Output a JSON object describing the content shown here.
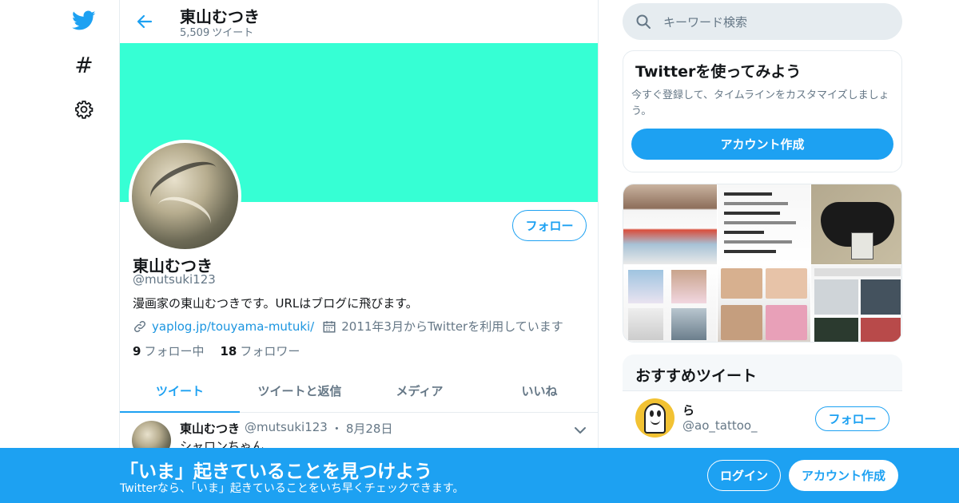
{
  "nav": {
    "icons": [
      "twitter-bird-icon",
      "hashtag-icon",
      "gear-icon"
    ],
    "hash_glyph": "#"
  },
  "header": {
    "name": "東山むつき",
    "tweet_count": "5,509",
    "tweet_count_label": "ツイート"
  },
  "profile": {
    "banner_color": "#36ffd4",
    "follow_label": "フォロー",
    "name": "東山むつき",
    "handle": "@mutsuki123",
    "bio": "漫画家の東山むつきです。URLはブログに飛びます。",
    "link": "yaplog.jp/touyama-mutuki/",
    "joined": "2011年3月からTwitterを利用しています",
    "following_count": "9",
    "following_label": "フォロー中",
    "followers_count": "18",
    "followers_label": "フォロワー"
  },
  "tabs": [
    {
      "label": "ツイート",
      "active": true
    },
    {
      "label": "ツイートと返信",
      "active": false
    },
    {
      "label": "メディア",
      "active": false
    },
    {
      "label": "いいね",
      "active": false
    }
  ],
  "tweet": {
    "name": "東山むつき",
    "handle": "@mutsuki123",
    "separator": "・",
    "date": "8月28日",
    "text": "シャロンちゃん"
  },
  "search": {
    "placeholder": "キーワード検索"
  },
  "signup_card": {
    "title": "Twitterを使ってみよう",
    "description": "今すぐ登録して、タイムラインをカスタマイズしましょう。",
    "button_label": "アカウント作成"
  },
  "recommended": {
    "heading": "おすすめツイート",
    "user_name": "ら",
    "user_handle": "@ao_tattoo_",
    "follow_label": "フォロー"
  },
  "bottom_bar": {
    "headline": "「いま」起きていることを見つけよう",
    "subline": "Twitterなら、「いま」起きていることをいち早くチェックできます。",
    "login_label": "ログイン",
    "signup_label": "アカウント作成"
  },
  "colors": {
    "accent": "#1da1f2",
    "banner": "#36ffd4",
    "muted": "#657786",
    "text": "#14171a"
  }
}
